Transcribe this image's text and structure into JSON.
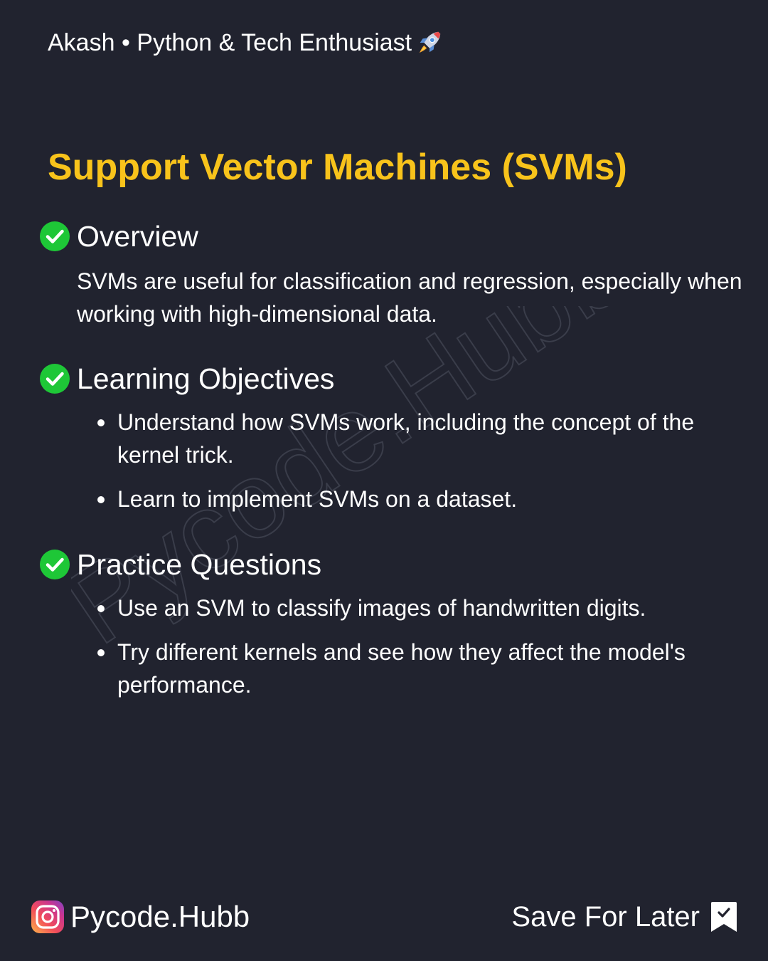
{
  "header": {
    "author_line": "Akash • Python & Tech Enthusiast",
    "author_icon": "rocket-icon"
  },
  "title": "Support Vector Machines (SVMs)",
  "colors": {
    "background": "#21232f",
    "title": "#f8c31b",
    "check": "#1ec737",
    "text": "#ffffff"
  },
  "sections": [
    {
      "heading": "Overview",
      "paragraph": "SVMs are useful for classification and regression, especially when working with high-dimensional data."
    },
    {
      "heading": "Learning Objectives",
      "bullets": [
        "Understand how SVMs work, including the concept of the kernel trick.",
        "Learn to implement SVMs on a dataset."
      ]
    },
    {
      "heading": "Practice Questions",
      "bullets": [
        "Use an SVM to classify images of handwritten digits.",
        "Try different kernels and see how they affect the model's performance."
      ]
    }
  ],
  "watermark": "Pycode.Hubb",
  "footer": {
    "brand_icon": "instagram-icon",
    "brand": "Pycode.Hubb",
    "save_label": "Save For Later",
    "save_icon": "bookmark-icon"
  }
}
